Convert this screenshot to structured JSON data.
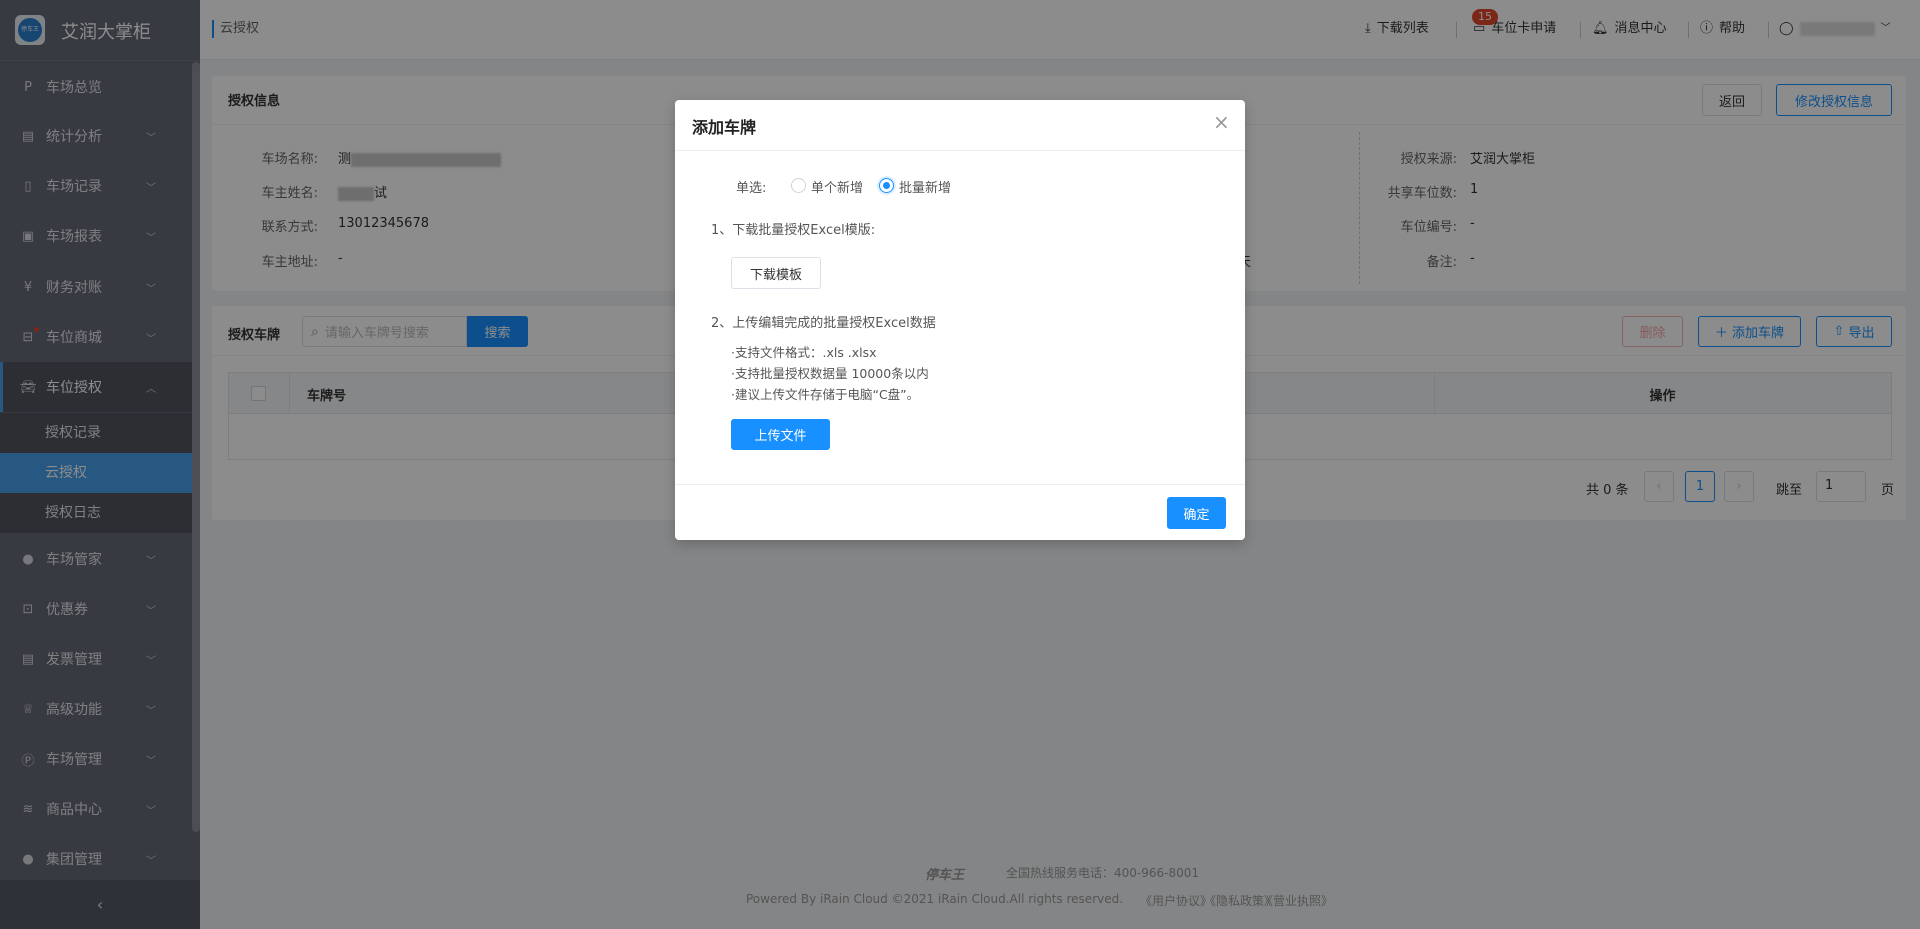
{
  "app": {
    "title": "艾润大掌柜",
    "logo_text": "停车王"
  },
  "sidebar": {
    "items": [
      {
        "label": "车场总览",
        "icon": "parking-icon"
      },
      {
        "label": "统计分析",
        "icon": "chart-icon"
      },
      {
        "label": "车场记录",
        "icon": "document-icon"
      },
      {
        "label": "车场报表",
        "icon": "report-icon"
      },
      {
        "label": "财务对账",
        "icon": "yen-icon"
      },
      {
        "label": "车位商城",
        "icon": "store-icon"
      },
      {
        "label": "车位授权",
        "icon": "car-icon"
      },
      {
        "label": "车场管家",
        "icon": "user-icon"
      },
      {
        "label": "优惠券",
        "icon": "ticket-icon"
      },
      {
        "label": "发票管理",
        "icon": "invoice-icon"
      },
      {
        "label": "高级功能",
        "icon": "crown-icon"
      },
      {
        "label": "车场管理",
        "icon": "parking-circle-icon"
      },
      {
        "label": "商品中心",
        "icon": "layers-icon"
      },
      {
        "label": "集团管理",
        "icon": "group-icon"
      }
    ],
    "subitems": [
      "授权记录",
      "云授权",
      "授权日志"
    ],
    "active_subitem": "云授权",
    "collapse": "‹"
  },
  "header": {
    "breadcrumb": "云授权",
    "download_list": "下载列表",
    "card_apply": "车位卡申请",
    "card_apply_badge": "15",
    "messages": "消息中心",
    "help": "帮助"
  },
  "auth_info": {
    "title": "授权信息",
    "back": "返回",
    "edit": "修改授权信息",
    "left": [
      {
        "label": "车场名称:",
        "value": "测"
      },
      {
        "label": "车主姓名:",
        "value": "试"
      },
      {
        "label": "联系方式:",
        "value": "13012345678"
      },
      {
        "label": "车主地址:",
        "value": "-"
      }
    ],
    "middle_partial": "天",
    "right": [
      {
        "label": "授权来源:",
        "value": "艾润大掌柜"
      },
      {
        "label": "共享车位数:",
        "value": "1"
      },
      {
        "label": "车位编号:",
        "value": "-"
      },
      {
        "label": "备注:",
        "value": "-"
      }
    ]
  },
  "plates": {
    "title": "授权车牌",
    "search_placeholder": "请输入车牌号搜索",
    "search": "搜索",
    "delete": "删除",
    "add": "添加车牌",
    "export": "导出",
    "columns": [
      "车牌号",
      "操作"
    ],
    "pagination": {
      "total": "共 0 条",
      "page": "1",
      "jump": "跳至",
      "jump_value": "1",
      "page_suffix": "页"
    }
  },
  "footer": {
    "logo": "停车王",
    "hotline": "全国热线服务电话：400-966-8001",
    "powered": "Powered By iRain Cloud ©2021 iRain Cloud.All rights reserved.",
    "links": [
      "《用户协议》",
      "《隐私政策》",
      "《营业执照》"
    ]
  },
  "modal": {
    "title": "添加车牌",
    "radio_label": "单选:",
    "options": [
      "单个新增",
      "批量新增"
    ],
    "selected": "批量新增",
    "step1": "1、下载批量授权Excel模版:",
    "download_template": "下载模板",
    "step2": "2、上传编辑完成的批量授权Excel数据",
    "notes": [
      "·支持文件格式：.xls .xlsx",
      "·支持批量授权数据量 10000条以内",
      "·建议上传文件存储于电脑“C盘”。"
    ],
    "upload": "上传文件",
    "confirm": "确定"
  },
  "colors": {
    "primary": "#1890ff",
    "sidebar": "#666b78",
    "badge": "#e0452b"
  }
}
